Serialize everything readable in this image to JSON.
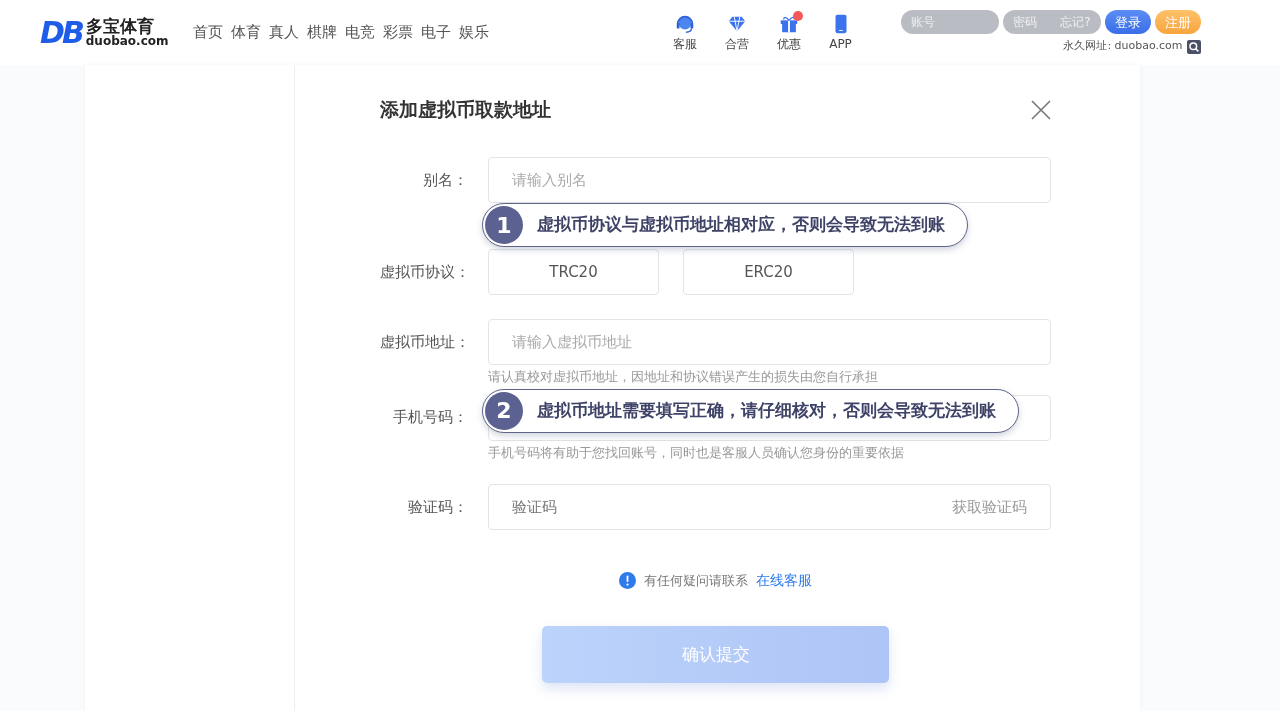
{
  "header": {
    "logo": {
      "mark": "DB",
      "name": "多宝体育",
      "domain": "duobao.com"
    },
    "nav": [
      {
        "label": "首页"
      },
      {
        "label": "体育"
      },
      {
        "label": "真人"
      },
      {
        "label": "棋牌"
      },
      {
        "label": "电竞"
      },
      {
        "label": "彩票"
      },
      {
        "label": "电子"
      },
      {
        "label": "娱乐"
      }
    ],
    "quick_links": [
      {
        "kind": "headset",
        "label": "客服",
        "badge": false
      },
      {
        "kind": "diamond",
        "label": "合营",
        "badge": false
      },
      {
        "kind": "gift",
        "label": "优惠",
        "badge": true
      },
      {
        "kind": "phone",
        "label": "APP",
        "badge": false
      }
    ],
    "login": {
      "account_placeholder": "账号",
      "password_placeholder": "密码",
      "forgot": "忘记?",
      "login_button": "登录",
      "register_button": "注册"
    },
    "permanent_url": {
      "label": "永久网址:",
      "url": "duobao.com"
    }
  },
  "modal": {
    "title": "添加虚拟币取款地址",
    "fields": [
      {
        "kind": "text",
        "label": "别名：",
        "placeholder": "请输入别名",
        "callout": {
          "number": "1",
          "text": "虚拟币协议与虚拟币地址相对应，否则会导致无法到账"
        }
      },
      {
        "kind": "choice",
        "label": "虚拟币协议：",
        "options": [
          {
            "label": "TRC20",
            "selected": false
          },
          {
            "label": "ERC20",
            "selected": false
          }
        ]
      },
      {
        "kind": "text",
        "label": "虚拟币地址：",
        "placeholder": "请输入虚拟币地址",
        "hint": "请认真校对虚拟币地址，因地址和协议错误产生的损失由您自行承担",
        "callout": {
          "number": "2",
          "text": "虚拟币地址需要填写正确，请仔细核对，否则会导致无法到账"
        }
      },
      {
        "kind": "text",
        "label": "手机号码：",
        "hint": "手机号码将有助于您找回账号，同时也是客服人员确认您身份的重要依据"
      },
      {
        "kind": "code",
        "label": "验证码：",
        "placeholder": "验证码",
        "action": "获取验证码"
      }
    ],
    "help": {
      "text": "有任何疑问请联系",
      "link": "在线客服"
    },
    "submit": {
      "label": "确认提交",
      "disabled": true
    }
  }
}
